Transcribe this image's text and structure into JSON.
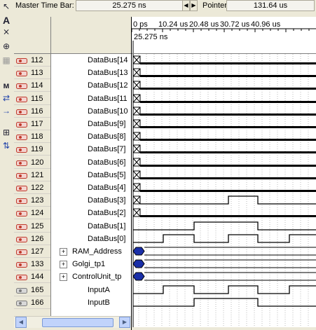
{
  "topbar": {
    "master_label": "Master Time Bar:",
    "master_value": "25.275 ns",
    "pointer_label": "Pointer:",
    "pointer_value": "131.64 us",
    "left_arrow": "◀",
    "right_arrow": "▶"
  },
  "timescale": {
    "ticks": [
      "0 ps",
      "10.24 us",
      "20.48 us",
      "30.72 us",
      "40.96 us"
    ],
    "cursor_label": "25.275 ns"
  },
  "signals": [
    {
      "id": "112",
      "name": "DataBus[14",
      "kind": "in",
      "wave": "bus_hold"
    },
    {
      "id": "113",
      "name": "DataBus[13",
      "kind": "in",
      "wave": "bus_hold"
    },
    {
      "id": "114",
      "name": "DataBus[12",
      "kind": "in",
      "wave": "bus_hold"
    },
    {
      "id": "115",
      "name": "DataBus[11",
      "kind": "in",
      "wave": "bus_hold"
    },
    {
      "id": "116",
      "name": "DataBus[10",
      "kind": "in",
      "wave": "bus_hold"
    },
    {
      "id": "117",
      "name": "DataBus[9]",
      "kind": "in",
      "wave": "bus_hold"
    },
    {
      "id": "118",
      "name": "DataBus[8]",
      "kind": "in",
      "wave": "bus_hold"
    },
    {
      "id": "119",
      "name": "DataBus[7]",
      "kind": "in",
      "wave": "bus_hold"
    },
    {
      "id": "120",
      "name": "DataBus[6]",
      "kind": "in",
      "wave": "bus_hold"
    },
    {
      "id": "121",
      "name": "DataBus[5]",
      "kind": "in",
      "wave": "bus_hold"
    },
    {
      "id": "122",
      "name": "DataBus[4]",
      "kind": "in",
      "wave": "bus_hold"
    },
    {
      "id": "123",
      "name": "DataBus[3]",
      "kind": "in",
      "wave": "pulse3"
    },
    {
      "id": "124",
      "name": "DataBus[2]",
      "kind": "in",
      "wave": "bus_hold"
    },
    {
      "id": "125",
      "name": "DataBus[1]",
      "kind": "in",
      "wave": "pulse1"
    },
    {
      "id": "126",
      "name": "DataBus[0]",
      "kind": "in",
      "wave": "pulse0"
    },
    {
      "id": "127",
      "name": "RAM_Address",
      "kind": "in",
      "wave": "group",
      "expandable": true
    },
    {
      "id": "133",
      "name": "Golgi_tp1",
      "kind": "in",
      "wave": "group",
      "expandable": true
    },
    {
      "id": "144",
      "name": "ControlUnit_tp",
      "kind": "in",
      "wave": "group",
      "expandable": true
    },
    {
      "id": "165",
      "name": "InputA",
      "kind": "out",
      "wave": "inputA"
    },
    {
      "id": "166",
      "name": "InputB",
      "kind": "out",
      "wave": "inputB"
    }
  ],
  "colors": {
    "bg": "#ece9d8",
    "wave": "#000000",
    "grid": "#808080",
    "node_icon_in": "#c0392b",
    "node_icon_out": "#7a7a7a",
    "group_marker": "#1a2fa8"
  },
  "toolbar_icons": [
    "pointer-icon",
    "text-tool-icon",
    "waveform-edit-icon",
    "zoom-icon",
    "copy-icon",
    "find-icon",
    "replace-icon",
    "arrow-icon",
    "sort-icon",
    "group-icon"
  ]
}
